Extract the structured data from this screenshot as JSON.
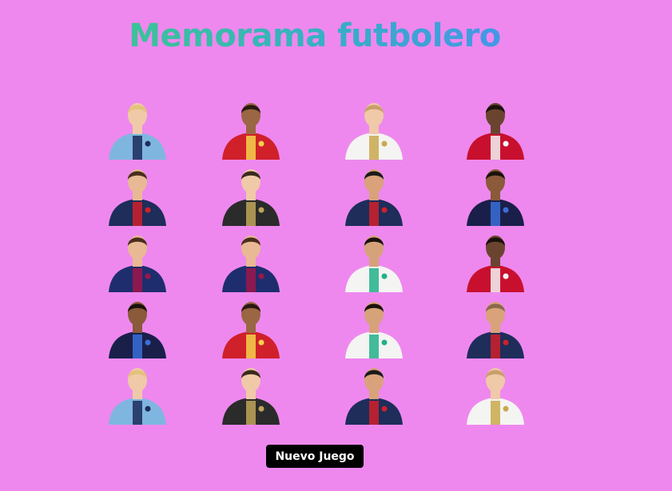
{
  "title": "Memorama futbolero",
  "new_game_label": "Nuevo Juego",
  "palette": {
    "background": "#ee88ee",
    "title_gradient": [
      "#3ed07a",
      "#36b1c2",
      "#4d85ff"
    ],
    "button": "#000000"
  },
  "cards": [
    {
      "player": "haaland",
      "kit": "#7fb6e0",
      "accent": "#1c2c5b",
      "skin": "#f0c9a8",
      "hair": "#e3c27a"
    },
    {
      "player": "salah",
      "kit": "#d0202a",
      "accent": "#f5d24a",
      "skin": "#9a6644",
      "hair": "#2a1a10"
    },
    {
      "player": "modric",
      "kit": "#f4f4f2",
      "accent": "#c9a84e",
      "skin": "#f0c9a8",
      "hair": "#c8a06a"
    },
    {
      "player": "van-dijk",
      "kit": "#c8102e",
      "accent": "#f5f5f5",
      "skin": "#6b4430",
      "hair": "#1a120c"
    },
    {
      "player": "messi-psg",
      "kit": "#1e2d5a",
      "accent": "#d0202a",
      "skin": "#e8b994",
      "hair": "#4a2e1a"
    },
    {
      "player": "courtois",
      "kit": "#2b2b2b",
      "accent": "#bfa65a",
      "skin": "#f0c9a8",
      "hair": "#3a2a1c"
    },
    {
      "player": "neymar",
      "kit": "#1e2d5a",
      "accent": "#d0202a",
      "skin": "#d9a27a",
      "hair": "#1a1a1a"
    },
    {
      "player": "mbappe",
      "kit": "#1a1f4a",
      "accent": "#3a6ed8",
      "skin": "#8a5a3a",
      "hair": "#1a120c"
    },
    {
      "player": "messi-barca",
      "kit": "#1e2d6e",
      "accent": "#a0164a",
      "skin": "#e8b994",
      "hair": "#4a2e1a"
    },
    {
      "player": "messi-barca",
      "kit": "#1e2d6e",
      "accent": "#a0164a",
      "skin": "#e8b994",
      "hair": "#4a2e1a"
    },
    {
      "player": "ronaldo",
      "kit": "#f4f4f2",
      "accent": "#21b08a",
      "skin": "#d6a27a",
      "hair": "#1a120c"
    },
    {
      "player": "van-dijk",
      "kit": "#c8102e",
      "accent": "#f5f5f5",
      "skin": "#6b4430",
      "hair": "#1a120c"
    },
    {
      "player": "mbappe",
      "kit": "#1a1f4a",
      "accent": "#3a6ed8",
      "skin": "#8a5a3a",
      "hair": "#1a120c"
    },
    {
      "player": "salah",
      "kit": "#d0202a",
      "accent": "#f5d24a",
      "skin": "#9a6644",
      "hair": "#2a1a10"
    },
    {
      "player": "ronaldo",
      "kit": "#f4f4f2",
      "accent": "#21b08a",
      "skin": "#d6a27a",
      "hair": "#1a120c"
    },
    {
      "player": "ramos",
      "kit": "#1e2d5a",
      "accent": "#d0202a",
      "skin": "#d9a27a",
      "hair": "#8a6a4a"
    },
    {
      "player": "haaland",
      "kit": "#7fb6e0",
      "accent": "#1c2c5b",
      "skin": "#f0c9a8",
      "hair": "#e3c27a"
    },
    {
      "player": "courtois",
      "kit": "#2b2b2b",
      "accent": "#bfa65a",
      "skin": "#f0c9a8",
      "hair": "#3a2a1c"
    },
    {
      "player": "neymar",
      "kit": "#1e2d5a",
      "accent": "#d0202a",
      "skin": "#d9a27a",
      "hair": "#1a1a1a"
    },
    {
      "player": "modric",
      "kit": "#f4f4f2",
      "accent": "#c9a84e",
      "skin": "#f0c9a8",
      "hair": "#c8a06a"
    }
  ]
}
